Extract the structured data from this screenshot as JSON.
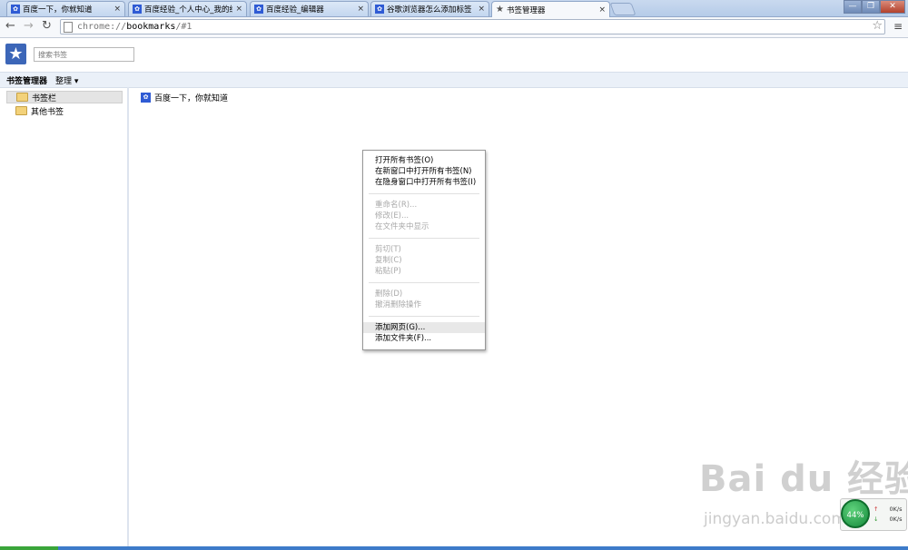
{
  "tabs": [
    {
      "title": "百度一下，你就知道",
      "active": false
    },
    {
      "title": "百度经验_个人中心_我的经",
      "active": false
    },
    {
      "title": "百度经验_编辑器",
      "active": false
    },
    {
      "title": "谷歌浏览器怎么添加标签",
      "active": false
    },
    {
      "title": "书签管理器",
      "active": true
    }
  ],
  "window_controls": {
    "minimize": "—",
    "maximize": "❐",
    "close": "✕"
  },
  "toolbar": {
    "back_icon": "←",
    "forward_icon": "→",
    "reload_icon": "↻",
    "url_scheme": "chrome://",
    "url_host": "bookmarks",
    "url_path": "/#1",
    "star_icon": "☆",
    "menu_icon": "≡"
  },
  "header": {
    "logo_glyph": "★",
    "search_placeholder": "搜索书签",
    "title": "书签管理器",
    "organize": "整理 ▾"
  },
  "tree": [
    {
      "label": "书签栏",
      "selected": true
    },
    {
      "label": "其他书签",
      "selected": false
    }
  ],
  "list": [
    {
      "title": "百度一下，你就知道",
      "favicon": "paw-icon"
    }
  ],
  "context_menu": [
    {
      "label": "打开所有书签(O)",
      "disabled": false
    },
    {
      "label": "在新窗口中打开所有书签(N)",
      "disabled": false
    },
    {
      "label": "在隐身窗口中打开所有书签(I)",
      "disabled": false
    },
    {
      "label": "重命名(R)...",
      "disabled": true
    },
    {
      "label": "修改(E)...",
      "disabled": true
    },
    {
      "label": "在文件夹中显示",
      "disabled": true
    },
    {
      "label": "剪切(T)",
      "disabled": true
    },
    {
      "label": "复制(C)",
      "disabled": true
    },
    {
      "label": "粘贴(P)",
      "disabled": true
    },
    {
      "label": "删除(D)",
      "disabled": true
    },
    {
      "label": "撤消删除操作",
      "disabled": true
    },
    {
      "label": "添加网页(G)...",
      "disabled": false,
      "hover": true
    },
    {
      "label": "添加文件夹(F)...",
      "disabled": false
    }
  ],
  "watermark": {
    "brand": "Bai du 经验",
    "url": "jingyan.baidu.com"
  },
  "net_monitor": {
    "percent": "44%",
    "up": "0K/s",
    "down": "0K/s",
    "up_arrow": "↑",
    "down_arrow": "↓"
  }
}
